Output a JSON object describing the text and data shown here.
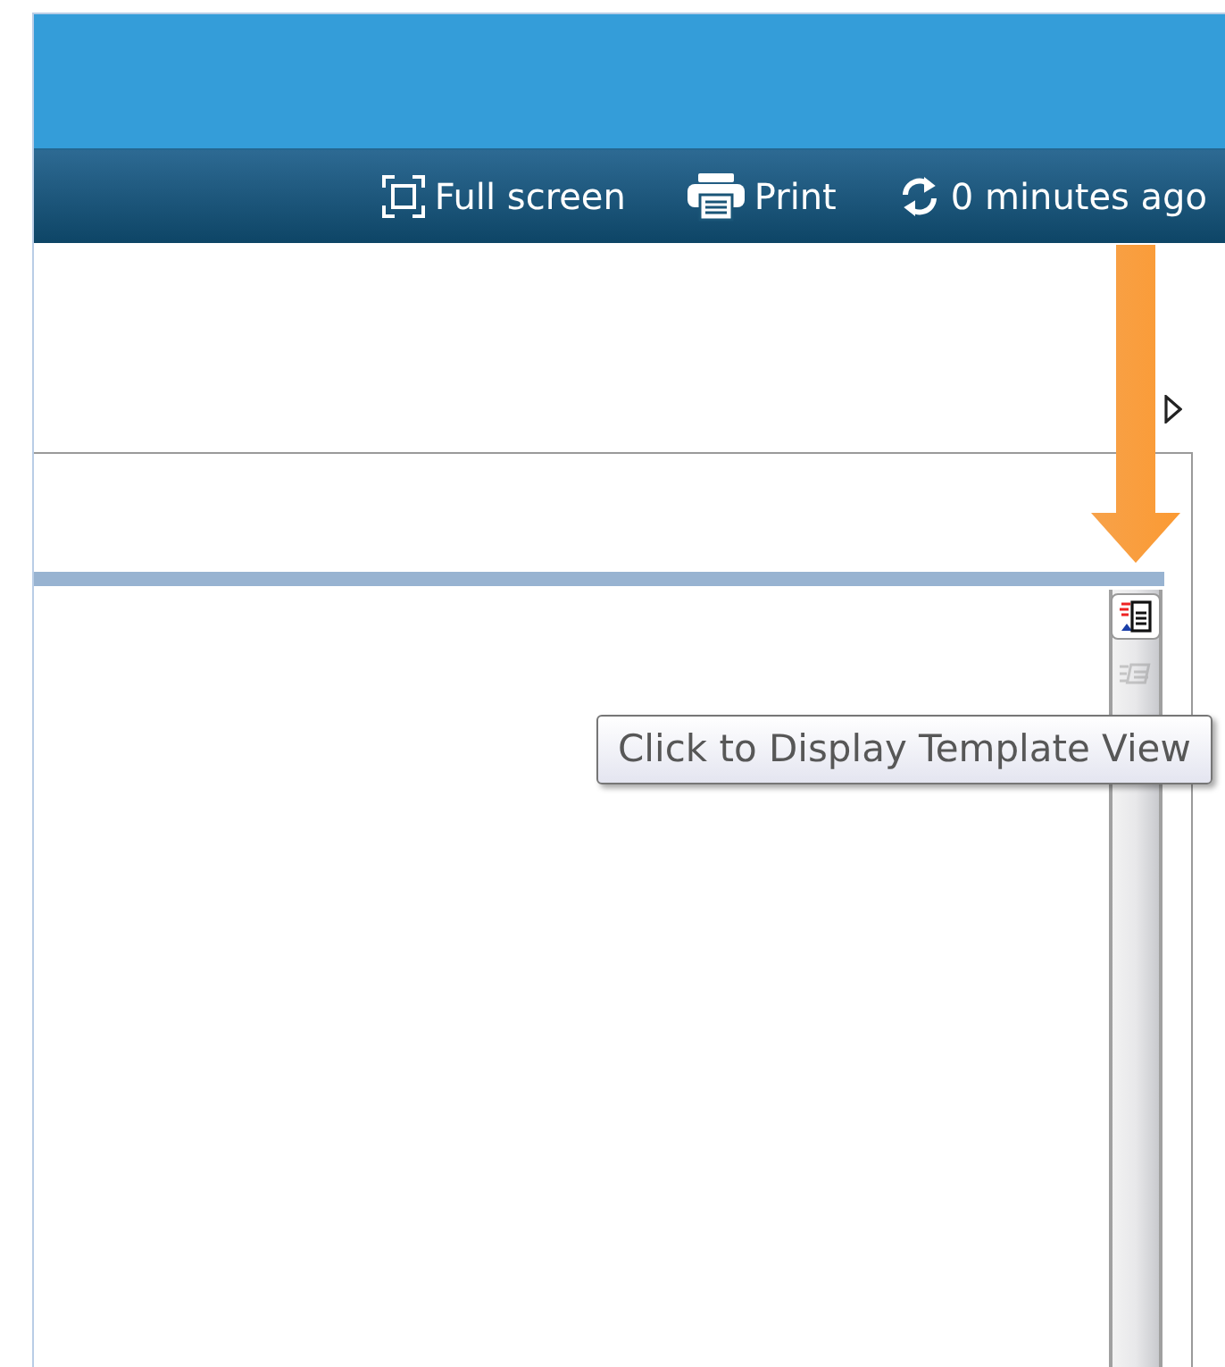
{
  "toolbar": [
    {
      "kind": "fullscreen",
      "label": "Full screen"
    },
    {
      "kind": "print",
      "label": "Print"
    },
    {
      "kind": "refresh",
      "label": "0 minutes ago"
    }
  ],
  "view_buttons": [
    {
      "kind": "template",
      "disabled": false
    },
    {
      "kind": "list",
      "disabled": true
    }
  ],
  "tooltip": "Click to Display Template View"
}
